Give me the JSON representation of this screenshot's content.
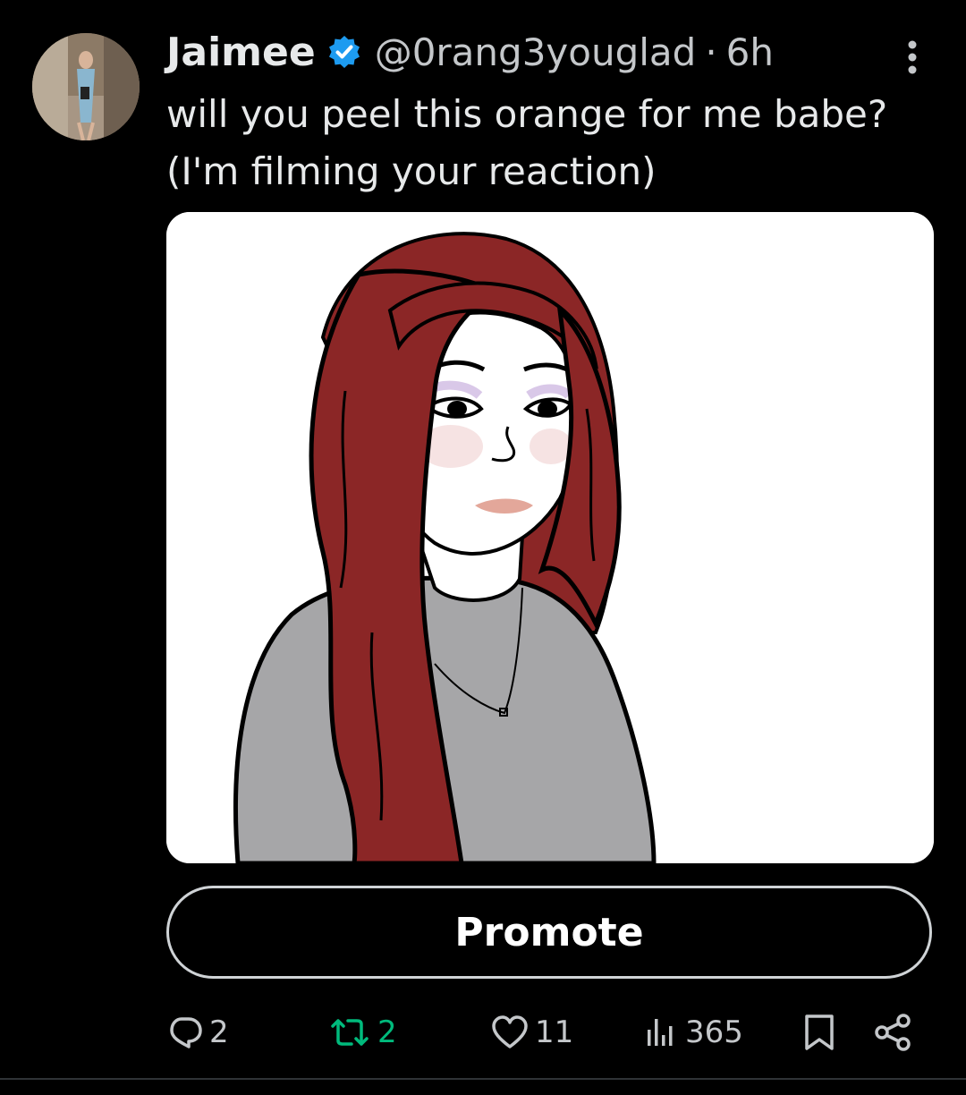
{
  "author": {
    "name": "Jaimee",
    "handle": "@0rang3youglad",
    "separator": "·",
    "time": "6h",
    "verified": true
  },
  "tweet": {
    "line1": "will you peel this orange for me babe?",
    "line2": "(I'm filming your reaction)"
  },
  "media": {
    "icon": "wojak-girl-illustration"
  },
  "promote_label": "Promote",
  "actions": {
    "replies": "2",
    "reposts": "2",
    "likes": "11",
    "views": "365"
  },
  "colors": {
    "background": "#000000",
    "text": "#e7e9ea",
    "secondary": "#c4c7ca",
    "verified": "#1d9bf0",
    "repost": "#00ba7c",
    "hair": "#8b2626",
    "sweater": "#a6a6a8"
  }
}
